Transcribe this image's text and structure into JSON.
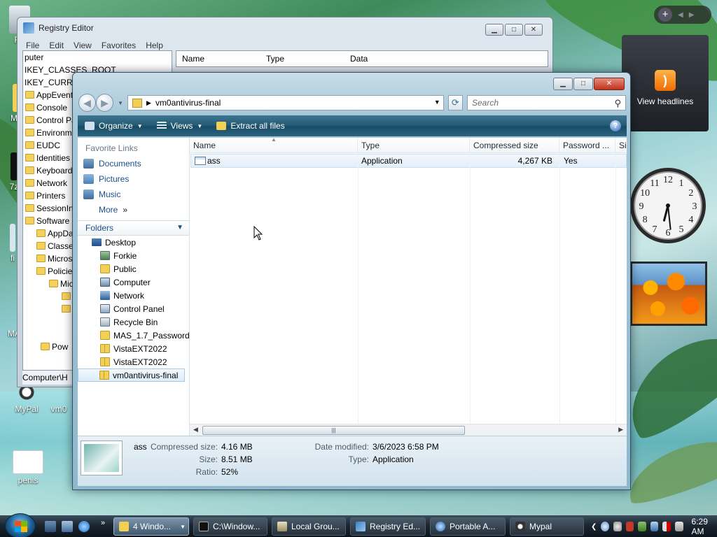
{
  "desktop": {
    "icons": [
      {
        "label": "Re"
      },
      {
        "label": "MA"
      },
      {
        "label": "7z"
      },
      {
        "label": "fi"
      },
      {
        "label": "MA"
      },
      {
        "label": "MyPal"
      },
      {
        "label": "vm0"
      },
      {
        "label": "penis"
      }
    ],
    "feed_gadget": {
      "label": "View headlines"
    },
    "clock": {
      "numbers": [
        "12",
        "1",
        "2",
        "3",
        "4",
        "5",
        "6",
        "7",
        "8",
        "9",
        "10",
        "11"
      ],
      "hour": 6,
      "minute": 29
    }
  },
  "registry_editor": {
    "title": "Registry Editor",
    "menu": [
      "File",
      "Edit",
      "View",
      "Favorites",
      "Help"
    ],
    "columns": [
      "Name",
      "Type",
      "Data"
    ],
    "tree": [
      "puter",
      "IKEY_CLASSES_ROOT",
      "IKEY_CURREN",
      "AppEvents",
      "Console",
      "Control Pa",
      "Environme",
      "EUDC",
      "Identities",
      "Keyboard L",
      "Network",
      "Printers",
      "SessionInfo",
      "Software",
      "AppDat",
      "Classes",
      "Microso",
      "Policies",
      "Mic",
      "",
      "",
      "",
      "",
      "Pow"
    ],
    "status": "Computer\\H"
  },
  "explorer": {
    "address_path": "vm0antivirus-final",
    "search_placeholder": "Search",
    "commands": {
      "organize": "Organize",
      "views": "Views",
      "extract": "Extract all files"
    },
    "favorite_links_title": "Favorite Links",
    "favorites": [
      "Documents",
      "Pictures",
      "Music"
    ],
    "more_label": "More",
    "folders_label": "Folders",
    "folders": [
      {
        "label": "Desktop",
        "icon": "desktop-icon"
      },
      {
        "label": "Forkie",
        "icon": "user-folder-icon"
      },
      {
        "label": "Public",
        "icon": "folder-icon"
      },
      {
        "label": "Computer",
        "icon": "computer-icon"
      },
      {
        "label": "Network",
        "icon": "network-icon"
      },
      {
        "label": "Control Panel",
        "icon": "control-panel-icon"
      },
      {
        "label": "Recycle Bin",
        "icon": "recycle-bin-icon"
      },
      {
        "label": "MAS_1.7_Password_",
        "icon": "folder-icon"
      },
      {
        "label": "VistaEXT2022",
        "icon": "zip-folder-icon"
      },
      {
        "label": "VistaEXT2022",
        "icon": "zip-folder-icon"
      },
      {
        "label": "vm0antivirus-final",
        "icon": "zip-folder-icon"
      }
    ],
    "columns": [
      "Name",
      "Type",
      "Compressed size",
      "Password ...",
      "Si"
    ],
    "files": [
      {
        "name": "ass",
        "type": "Application",
        "compressed_size": "4,267 KB",
        "password": "Yes"
      }
    ],
    "details": {
      "name": "ass",
      "compressed_size_label": "Compressed size:",
      "compressed_size": "4.16 MB",
      "size_label": "Size:",
      "size": "8.51 MB",
      "ratio_label": "Ratio:",
      "ratio": "52%",
      "date_modified_label": "Date modified:",
      "date_modified": "3/6/2023 6:58 PM",
      "type_label": "Type:",
      "type": "Application"
    }
  },
  "taskbar": {
    "tasks": [
      {
        "label": "4 Windo...",
        "icon": "folder-icon"
      },
      {
        "label": "C:\\Window...",
        "icon": "cmd-icon"
      },
      {
        "label": "Local Grou...",
        "icon": "policy-icon"
      },
      {
        "label": "Registry Ed...",
        "icon": "registry-icon"
      },
      {
        "label": "Portable A...",
        "icon": "globe-icon"
      },
      {
        "label": "Mypal",
        "icon": "mypal-icon"
      }
    ],
    "ql_more": "»",
    "time": "6:29 AM"
  }
}
